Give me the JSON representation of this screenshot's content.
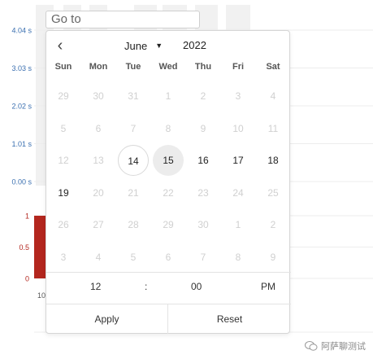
{
  "chart_data": [
    {
      "type": "bar",
      "ylim": [
        0,
        4.04
      ],
      "yticks": [
        "4.04 s",
        "3.03 s",
        "2.02 s",
        "1.01 s",
        "0.00 s"
      ],
      "axis_color": "#3a6fb0"
    },
    {
      "type": "bar",
      "ylim": [
        0,
        1
      ],
      "yticks": [
        "1",
        "0.5",
        "0"
      ],
      "values": [
        1
      ],
      "bar_color": "#b3261e",
      "axis_color": "#b3261e",
      "x_tick_fragment": "10"
    }
  ],
  "goto": {
    "placeholder": "Go to"
  },
  "datepicker": {
    "prev_icon": "chevron-left",
    "month": "June",
    "year": "2022",
    "weekdays": [
      "Sun",
      "Mon",
      "Tue",
      "Wed",
      "Thu",
      "Fri",
      "Sat"
    ],
    "weeks": [
      [
        "29",
        "30",
        "31",
        "1",
        "2",
        "3",
        "4"
      ],
      [
        "5",
        "6",
        "7",
        "8",
        "9",
        "10",
        "11"
      ],
      [
        "12",
        "13",
        "14",
        "15",
        "16",
        "17",
        "18"
      ],
      [
        "19",
        "20",
        "21",
        "22",
        "23",
        "24",
        "25"
      ],
      [
        "26",
        "27",
        "28",
        "29",
        "30",
        "1",
        "2"
      ],
      [
        "3",
        "4",
        "5",
        "6",
        "7",
        "8",
        "9"
      ]
    ],
    "enabled_days": [
      "14",
      "15",
      "16",
      "17",
      "18",
      "19"
    ],
    "today": "14",
    "selected": "15",
    "time": {
      "hour": "12",
      "separator": ":",
      "minute": "00",
      "ampm": "PM"
    },
    "buttons": {
      "apply": "Apply",
      "reset": "Reset"
    }
  },
  "watermark": "阿萨聊测试"
}
